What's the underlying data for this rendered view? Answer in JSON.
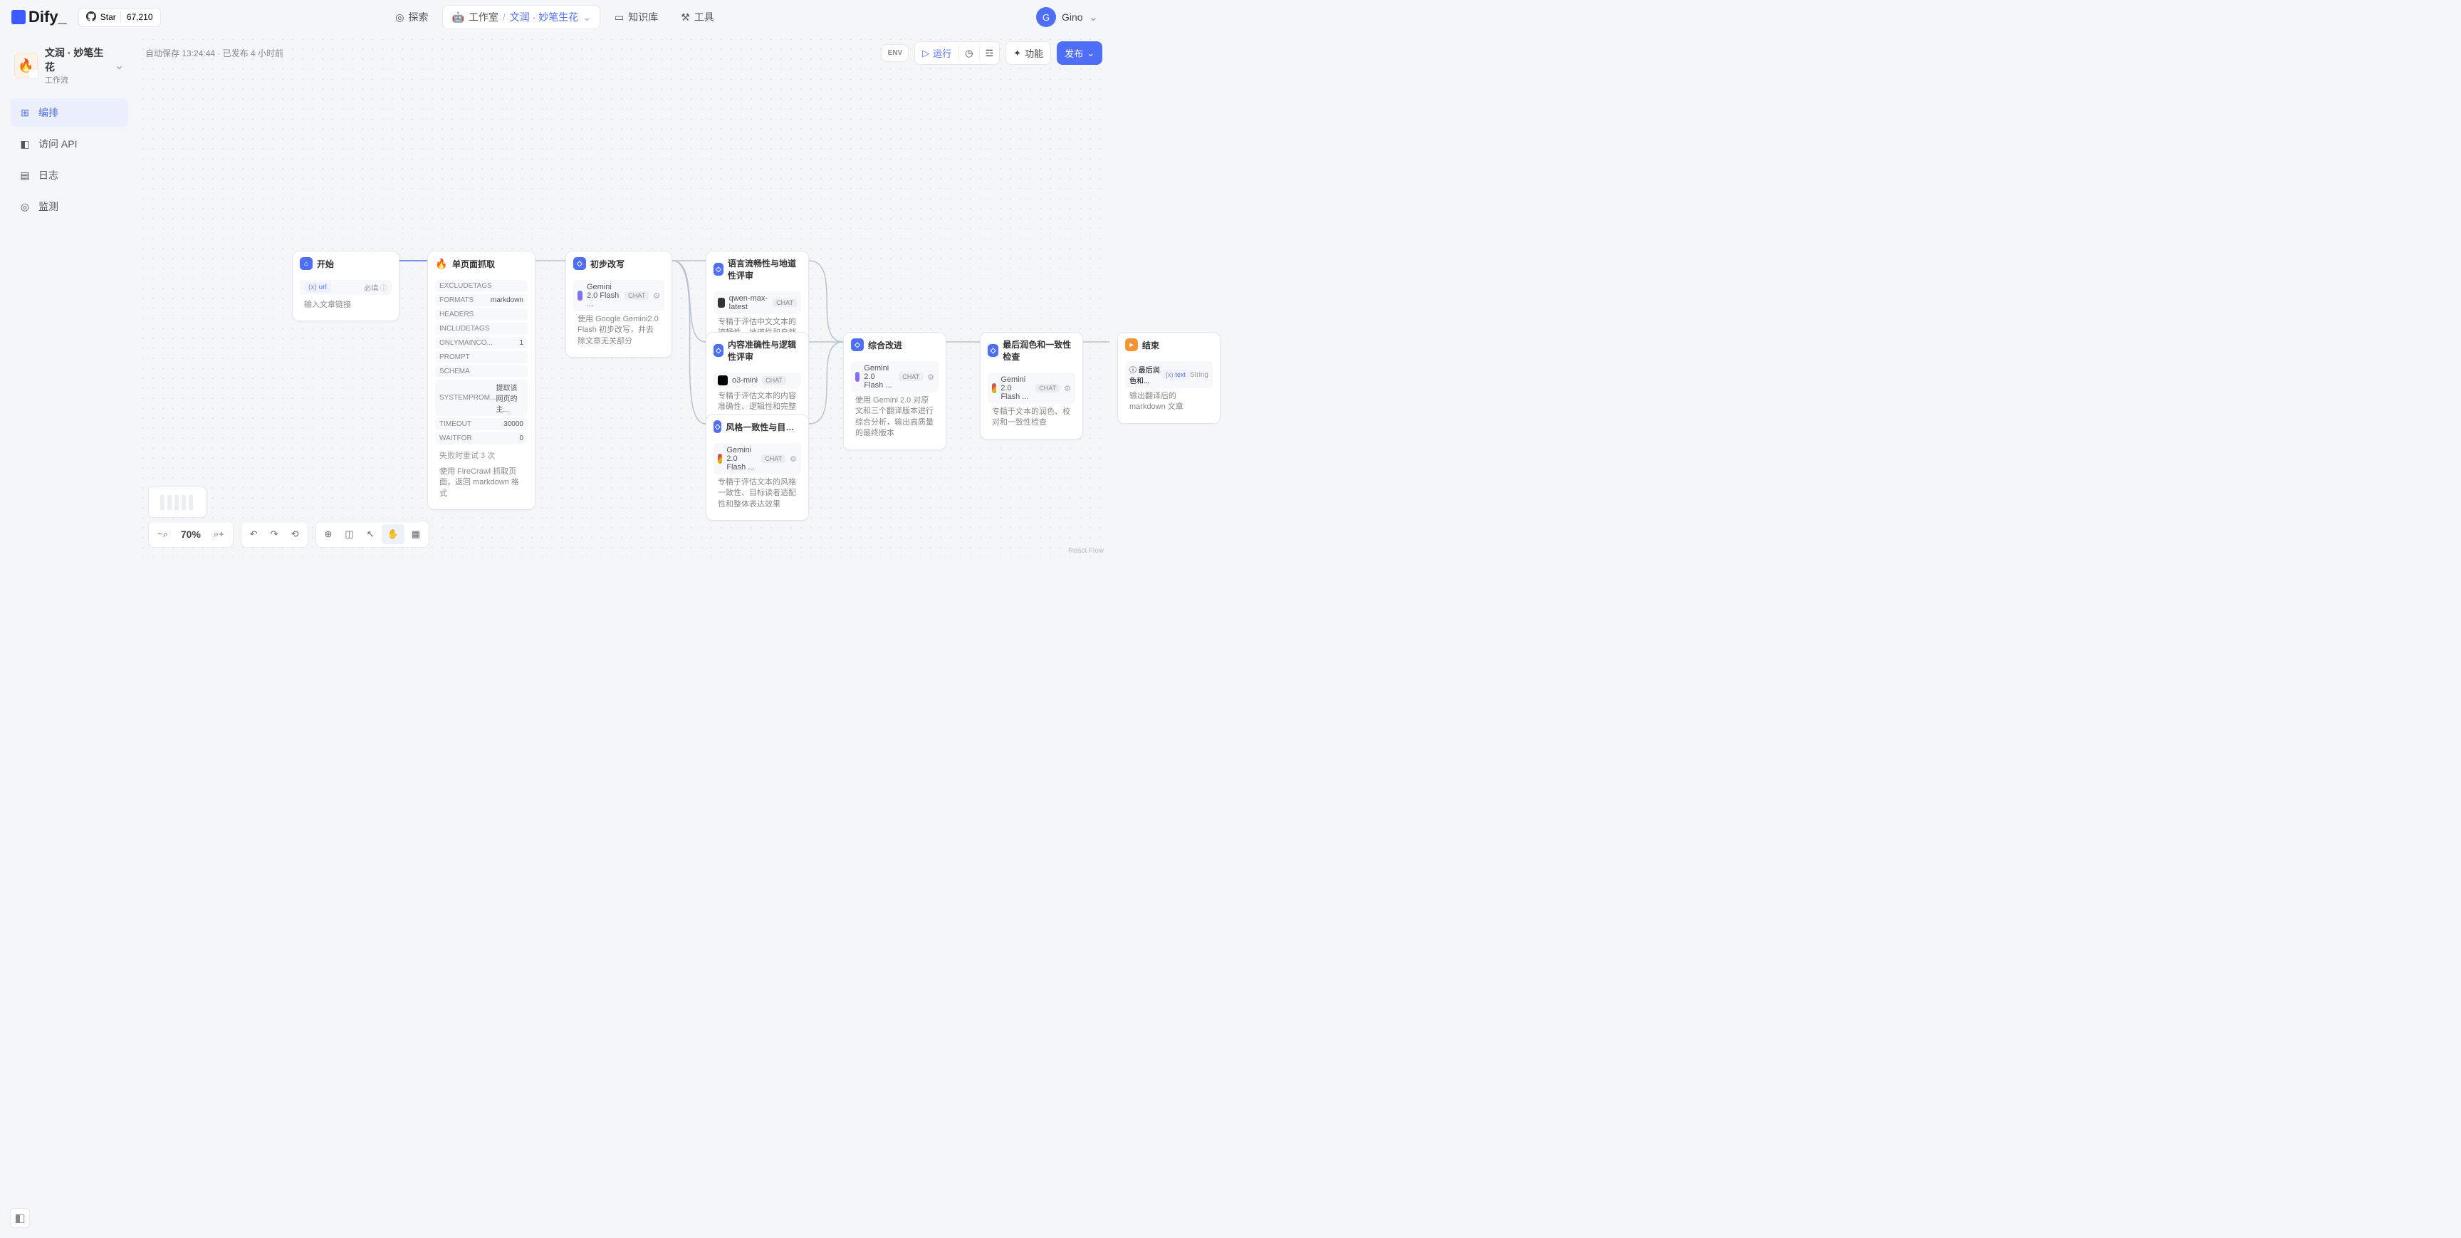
{
  "brand": "Dify_",
  "github": {
    "label": "Star",
    "count": "67,210"
  },
  "nav": {
    "explore": "探索",
    "workspace": "工作室",
    "breadcrumb": "文润 · 妙笔生花",
    "knowledge": "知识库",
    "tools": "工具"
  },
  "user": {
    "initial": "G",
    "name": "Gino"
  },
  "app": {
    "icon": "🔥",
    "title": "文润 · 妙笔生花",
    "subtitle": "工作流"
  },
  "sidebar": {
    "items": [
      {
        "icon": "⊞",
        "label": "编排"
      },
      {
        "icon": "◧",
        "label": "访问 API"
      },
      {
        "icon": "▤",
        "label": "日志"
      },
      {
        "icon": "◎",
        "label": "监测"
      }
    ]
  },
  "status": "自动保存 13:24:44 · 已发布 4 小时前",
  "topbar": {
    "env": "ENV",
    "run": "运行",
    "features": "功能",
    "publish": "发布"
  },
  "nodes": {
    "start": {
      "title": "开始",
      "var": "url",
      "required": "必填",
      "desc": "输入文章链接"
    },
    "scrape": {
      "title": "单页面抓取",
      "params": [
        {
          "k": "EXCLUDETAGS",
          "v": ""
        },
        {
          "k": "FORMATS",
          "v": "markdown"
        },
        {
          "k": "HEADERS",
          "v": ""
        },
        {
          "k": "INCLUDETAGS",
          "v": ""
        },
        {
          "k": "ONLYMAINCO...",
          "v": "1"
        },
        {
          "k": "PROMPT",
          "v": ""
        },
        {
          "k": "SCHEMA",
          "v": ""
        },
        {
          "k": "SYSTEMPROM...",
          "v": "提取该网页的主..."
        },
        {
          "k": "TIMEOUT",
          "v": "30000"
        },
        {
          "k": "WAITFOR",
          "v": "0"
        }
      ],
      "retry": "失败时重试 3 次",
      "desc": "使用 FireCrawl 抓取页面，返回 markdown 格式"
    },
    "rewrite": {
      "title": "初步改写",
      "model": "Gemini 2.0 Flash ...",
      "badge": "CHAT",
      "desc": "使用 Google Gemini2.0 Flash 初步改写，并去除文章无关部分"
    },
    "fluency": {
      "title": "语言流畅性与地道性评审",
      "model": "qwen-max-latest",
      "badge": "CHAT",
      "desc": "专精于评估中文文本的流畅性、地道性和自然度"
    },
    "accuracy": {
      "title": "内容准确性与逻辑性评审",
      "model": "o3-mini",
      "badge": "CHAT",
      "desc": "专精于评估文本的内容准确性、逻辑性和完整性"
    },
    "style": {
      "title": "风格一致性与目标读者适配性评",
      "model": "Gemini 2.0 Flash ...",
      "badge": "CHAT",
      "desc": "专精于评估文本的风格一致性、目标读者适配性和整体表达效果"
    },
    "improve": {
      "title": "综合改进",
      "model": "Gemini 2.0 Flash ...",
      "badge": "CHAT",
      "desc": "使用 Gemini 2.0 对原文和三个翻译版本进行综合分析，输出高质量的最终版本"
    },
    "polish": {
      "title": "最后润色和一致性检查",
      "model": "Gemini 2.0 Flash ...",
      "badge": "CHAT",
      "desc": "专精于文本的润色、校对和一致性检查"
    },
    "end": {
      "title": "结束",
      "outLabel": "最后润色和...",
      "outVar": "text",
      "outType": "String",
      "desc": "输出翻译后的 markdown 文章"
    }
  },
  "zoom": "70%",
  "attrib": "React Flow"
}
